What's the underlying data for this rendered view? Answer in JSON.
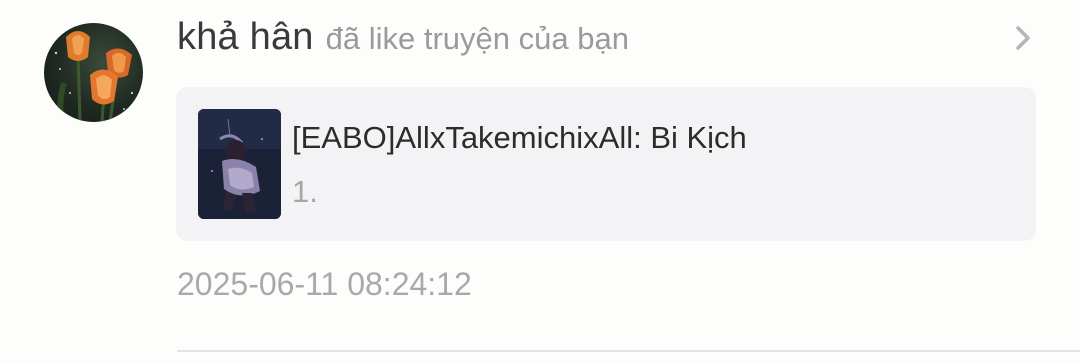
{
  "notification": {
    "user_name": "khả hân",
    "action_text": "đã like truyện của bạn",
    "avatar_icon": "tulip-avatar-image",
    "chevron_icon": "chevron-right-icon",
    "story": {
      "title": "[EABO]AllxTakemichixAll: Bi Kịch",
      "chapter": "1.",
      "cover_icon": "story-cover-image"
    },
    "timestamp": "2025-06-11 08:24:12"
  }
}
